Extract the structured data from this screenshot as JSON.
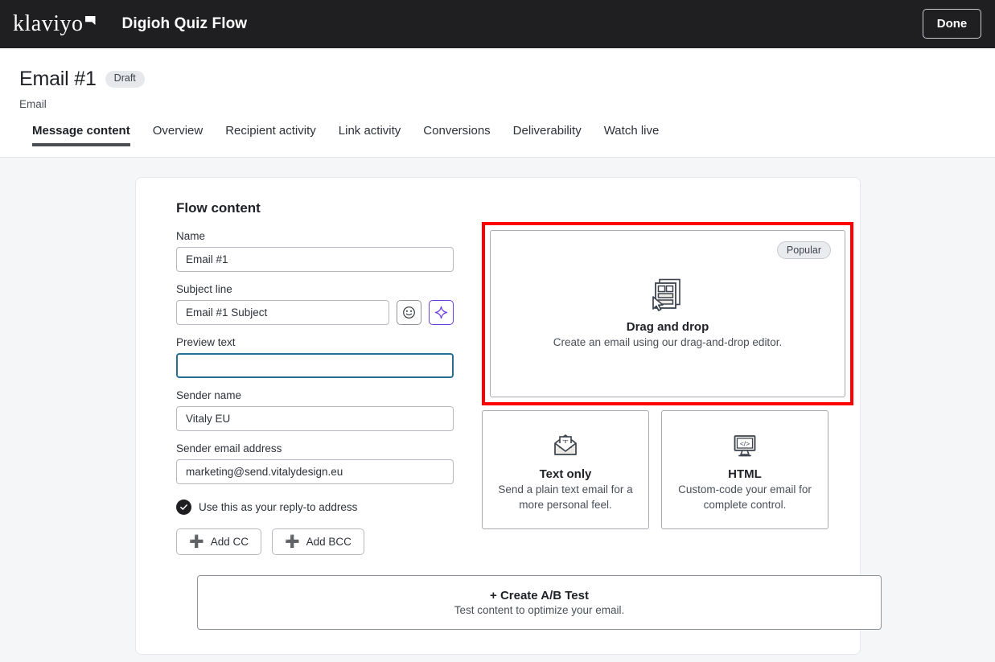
{
  "topbar": {
    "brand": "klaviyo",
    "app_title": "Digioh Quiz Flow",
    "done_label": "Done"
  },
  "page_header": {
    "title": "Email #1",
    "status_badge": "Draft",
    "subtitle": "Email",
    "tabs": [
      {
        "label": "Message content",
        "active": true
      },
      {
        "label": "Overview",
        "active": false
      },
      {
        "label": "Recipient activity",
        "active": false
      },
      {
        "label": "Link activity",
        "active": false
      },
      {
        "label": "Conversions",
        "active": false
      },
      {
        "label": "Deliverability",
        "active": false
      },
      {
        "label": "Watch live",
        "active": false
      }
    ]
  },
  "flow_content": {
    "section_title": "Flow content",
    "fields": {
      "name": {
        "label": "Name",
        "value": "Email #1",
        "placeholder": ""
      },
      "subject_line": {
        "label": "Subject line",
        "value": "Email #1 Subject",
        "placeholder": ""
      },
      "preview_text": {
        "label": "Preview text",
        "value": "",
        "placeholder": ""
      },
      "sender_name": {
        "label": "Sender name",
        "value": "Vitaly EU",
        "placeholder": ""
      },
      "sender_email": {
        "label": "Sender email address",
        "value": "marketing@send.vitalydesign.eu",
        "placeholder": ""
      }
    },
    "emoji_button_icon": "smiley-icon",
    "ai_button_icon": "sparkle-icon",
    "reply_to_checkbox": {
      "label": "Use this as your reply-to address",
      "checked": true
    },
    "add_cc_label": "Add CC",
    "add_bcc_label": "Add BCC"
  },
  "templates": {
    "drag_and_drop": {
      "badge": "Popular",
      "name": "Drag and drop",
      "description": "Create an email using our drag-and-drop editor.",
      "icon": "template-cursor-icon",
      "highlight_color": "#fe0000",
      "highlighted": true
    },
    "text_only": {
      "name": "Text only",
      "description": "Send a plain text email for a more personal feel.",
      "icon": "envelope-text-icon"
    },
    "html": {
      "name": "HTML",
      "description": "Custom-code your email for complete control.",
      "icon": "monitor-code-icon"
    }
  },
  "ab_test": {
    "title": "+ Create A/B Test",
    "subtitle": "Test content to optimize your email."
  },
  "colors": {
    "topbar_bg": "#1f1f21",
    "accent_purple": "#6b3ce0",
    "focus_blue": "#276f8e",
    "highlight_red": "#fe0000",
    "page_bg": "#f5f6f8"
  }
}
